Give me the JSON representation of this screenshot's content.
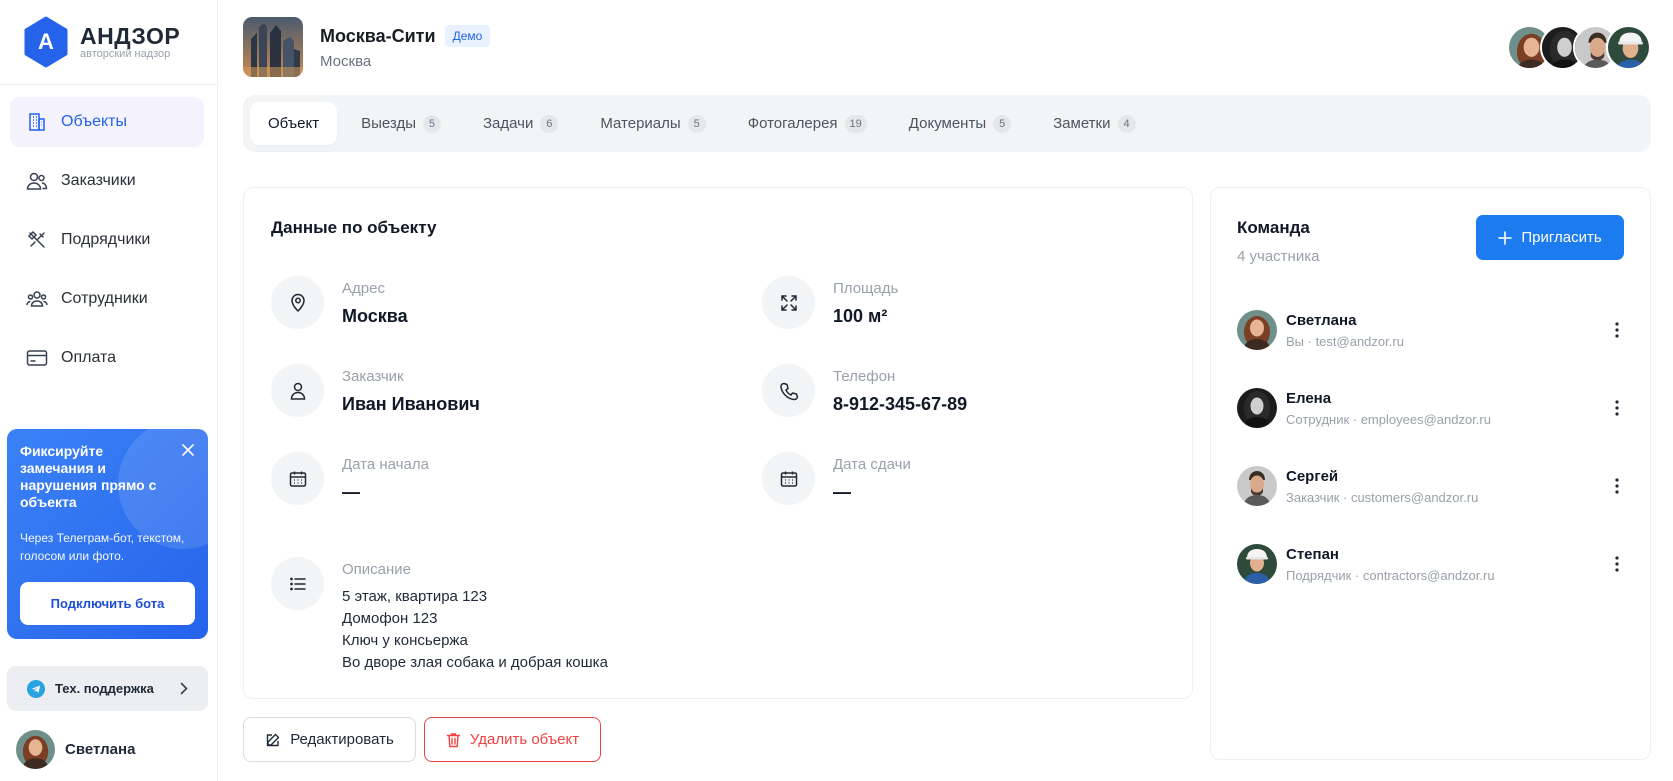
{
  "brand": {
    "letter": "А",
    "title": "АНДЗОР",
    "subtitle": "авторский надзор",
    "color": "#2563eb"
  },
  "sidebar": {
    "items": [
      {
        "label": "Объекты",
        "icon": "building-icon",
        "active": true
      },
      {
        "label": "Заказчики",
        "icon": "users-icon",
        "active": false
      },
      {
        "label": "Подрядчики",
        "icon": "tools-icon",
        "active": false
      },
      {
        "label": "Сотрудники",
        "icon": "team-icon",
        "active": false
      },
      {
        "label": "Оплата",
        "icon": "card-icon",
        "active": false
      }
    ],
    "promo": {
      "title": "Фиксируйте замечания и нарушения прямо с объекта",
      "text": "Через Телеграм-бот, текстом, голосом или фото.",
      "button": "Подключить бота"
    },
    "support": {
      "label": "Тех. поддержка",
      "icon": "telegram-icon"
    },
    "user": {
      "name": "Светлана"
    }
  },
  "header": {
    "object_name": "Москва-Сити",
    "badge": "Демо",
    "city": "Москва"
  },
  "tabs": [
    {
      "label": "Объект",
      "count": "",
      "active": true
    },
    {
      "label": "Выезды",
      "count": "5"
    },
    {
      "label": "Задачи",
      "count": "6"
    },
    {
      "label": "Материалы",
      "count": "5"
    },
    {
      "label": "Фотогалерея",
      "count": "19"
    },
    {
      "label": "Документы",
      "count": "5"
    },
    {
      "label": "Заметки",
      "count": "4"
    }
  ],
  "object_card": {
    "title": "Данные по объекту",
    "fields": {
      "address": {
        "label": "Адрес",
        "value": "Москва",
        "icon": "location-icon"
      },
      "area": {
        "label": "Площадь",
        "value": "100 м²",
        "icon": "expand-icon"
      },
      "client": {
        "label": "Заказчик",
        "value": "Иван Иванович",
        "icon": "person-icon"
      },
      "phone": {
        "label": "Телефон",
        "value": "8-912-345-67-89",
        "icon": "phone-icon"
      },
      "start": {
        "label": "Дата начала",
        "value": "—",
        "icon": "calendar-icon"
      },
      "end": {
        "label": "Дата сдачи",
        "value": "—",
        "icon": "calendar-icon"
      }
    },
    "description": {
      "label": "Описание",
      "icon": "list-icon",
      "lines": [
        "5 этаж, квартира 123",
        "Домофон 123",
        "Ключ у консьержа",
        "Во дворе злая собака и добрая кошка"
      ]
    }
  },
  "actions": {
    "edit": "Редактировать",
    "delete": "Удалить объект"
  },
  "team": {
    "title": "Команда",
    "count": "4 участника",
    "invite": "Пригласить",
    "members": [
      {
        "name": "Светлана",
        "meta": "Вы · test@andzor.ru"
      },
      {
        "name": "Елена",
        "meta": "Сотрудник · employees@andzor.ru"
      },
      {
        "name": "Сергей",
        "meta": "Заказчик · customers@andzor.ru"
      },
      {
        "name": "Степан",
        "meta": "Подрядчик · contractors@andzor.ru"
      }
    ]
  },
  "colors": {
    "accent": "#2563eb",
    "invite": "#1d7bf0",
    "danger": "#ef4444",
    "active_nav_bg": "#f3f2fd"
  }
}
